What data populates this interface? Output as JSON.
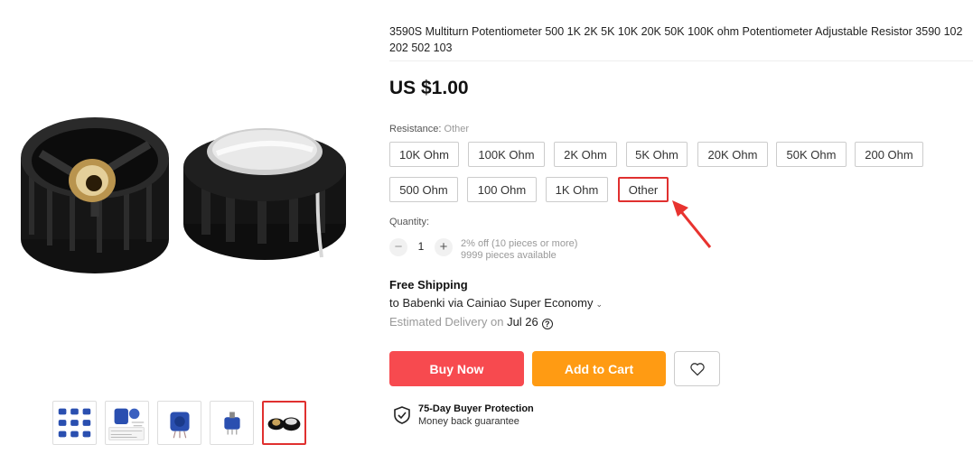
{
  "gallery": {
    "thumb_count": 5,
    "active_index": 4
  },
  "product": {
    "title": "3590S Multiturn Potentiometer 500 1K 2K 5K 10K 20K 50K 100K ohm Potentiometer Adjustable Resistor 3590 102 202 502 103",
    "price": "US $1.00"
  },
  "resistance": {
    "label": "Resistance:",
    "selected": "Other",
    "options": [
      "10K Ohm",
      "100K Ohm",
      "2K Ohm",
      "5K Ohm",
      "20K Ohm",
      "50K Ohm",
      "200 Ohm",
      "500 Ohm",
      "100 Ohm",
      "1K Ohm",
      "Other"
    ]
  },
  "quantity": {
    "label": "Quantity:",
    "value": "1",
    "minus": "−",
    "plus": "+",
    "discount": "2% off (10 pieces or more)",
    "available": "9999 pieces available"
  },
  "shipping": {
    "title": "Free Shipping",
    "to": "to Babenki via Cainiao Super Economy",
    "delivery_prefix": "Estimated Delivery on",
    "delivery_date": "Jul 26"
  },
  "actions": {
    "buy_now": "Buy Now",
    "add_to_cart": "Add to Cart"
  },
  "protection": {
    "title": "75-Day Buyer Protection",
    "subtitle": "Money back guarantee"
  },
  "colors": {
    "buy_now": "#f74a4f",
    "add_to_cart": "#ff9b13",
    "selected_border": "#e0302f",
    "annotation_arrow": "#e8332f"
  }
}
